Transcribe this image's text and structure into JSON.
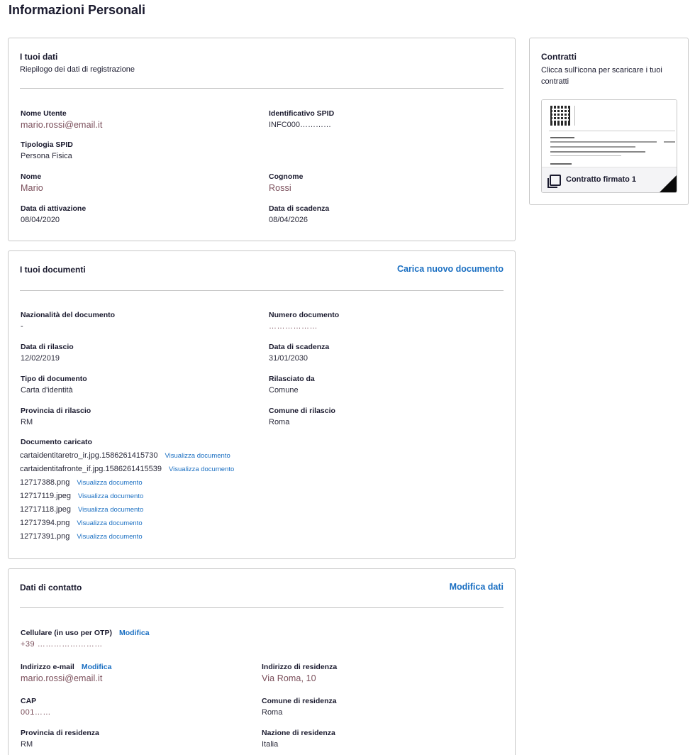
{
  "page": {
    "title": "Informazioni Personali"
  },
  "dati": {
    "title": "I tuoi dati",
    "subtitle": "Riepilogo dei dati di registrazione",
    "nome_utente_label": "Nome Utente",
    "nome_utente": "mario.rossi@email.it",
    "spid_id_label": "Identificativo SPID",
    "spid_id": "INFC000…………",
    "tipologia_label": "Tipologia SPID",
    "tipologia": "Persona Fisica",
    "nome_label": "Nome",
    "nome": "Mario",
    "cognome_label": "Cognome",
    "cognome": "Rossi",
    "attivazione_label": "Data di attivazione",
    "attivazione": "08/04/2020",
    "scadenza_label": "Data di scadenza",
    "scadenza": "08/04/2026"
  },
  "contratti": {
    "title": "Contratti",
    "subtitle": "Clicca sull'icona per scaricare i tuoi contratti",
    "contract_label": "Contratto firmato 1",
    "icon": "pdf-icon"
  },
  "documenti": {
    "title": "I tuoi documenti",
    "upload_link": "Carica nuovo documento",
    "nazionalita_label": "Nazionalità del documento",
    "nazionalita": "-",
    "numero_label": "Numero documento",
    "numero": "………………",
    "rilascio_label": "Data di rilascio",
    "rilascio": "12/02/2019",
    "scadenza_label": "Data di scadenza",
    "scadenza": "31/01/2030",
    "tipo_label": "Tipo di documento",
    "tipo": "Carta d'identità",
    "rilasciato_label": "Rilasciato da",
    "rilasciato": "Comune",
    "provincia_label": "Provincia di rilascio",
    "provincia": "RM",
    "comune_label": "Comune di rilascio",
    "comune": "Roma",
    "caricato_label": "Documento caricato",
    "view_link": "Visualizza documento",
    "files": [
      "cartaidentitaretro_ir.jpg.1586261415730",
      "cartaidentitafronte_if.jpg.1586261415539",
      "12717388.png",
      "12717119.jpeg",
      "12717118.jpeg",
      "12717394.png",
      "12717391.png"
    ]
  },
  "contatti": {
    "title": "Dati di contatto",
    "edit_link": "Modifica dati",
    "modifica": "Modifica",
    "cellulare_label": "Cellulare (in uso per OTP)",
    "cellulare": "+39 ……………………",
    "email_label": "Indirizzo e-mail",
    "email": "mario.rossi@email.it",
    "indirizzo_label": "Indirizzo di residenza",
    "indirizzo": "Via Roma, 10",
    "cap_label": "CAP",
    "cap": "001……",
    "comune_label": "Comune di residenza",
    "comune": "Roma",
    "provincia_label": "Provincia di residenza",
    "provincia": "RM",
    "nazione_label": "Nazione di residenza",
    "nazione": "Italia"
  }
}
